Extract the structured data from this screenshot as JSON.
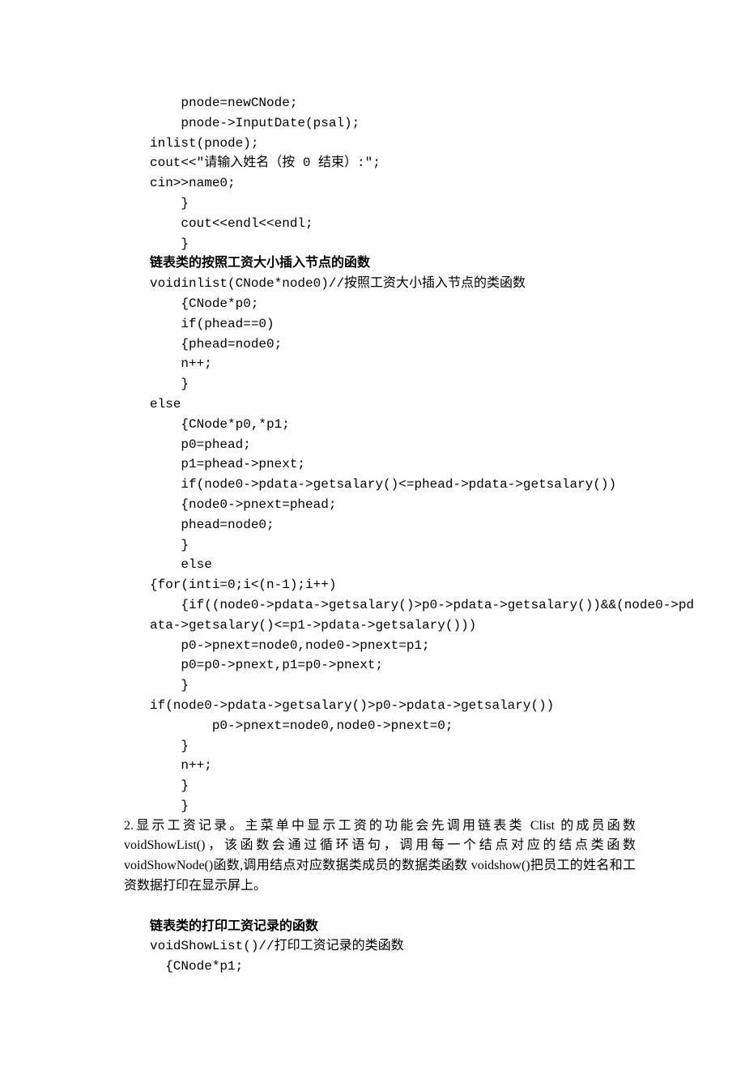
{
  "code_block1": {
    "lines": [
      "    pnode=newCNode;",
      "    pnode->InputDate(psal);",
      "inlist(pnode);",
      "cout<<\"请输入姓名（按 0 结束）:\";",
      "cin>>name0;",
      "    }",
      "    cout<<endl<<endl;",
      "    }"
    ]
  },
  "heading1": "链表类的按照工资大小插入节点的函数",
  "code_block2": {
    "lines": [
      "voidinlist(CNode*node0)//按照工资大小插入节点的类函数",
      "    {CNode*p0;",
      "    if(phead==0)",
      "    {phead=node0;",
      "    n++;",
      "    }",
      "else",
      "    {CNode*p0,*p1;",
      "    p0=phead;",
      "    p1=phead->pnext;",
      "    if(node0->pdata->getsalary()<=phead->pdata->getsalary())",
      "    {node0->pnext=phead;",
      "    phead=node0;",
      "    }",
      "    else",
      "{for(inti=0;i<(n-1);i++)",
      "    {if((node0->pdata->getsalary()>p0->pdata->getsalary())&&(node0->pd",
      "ata->getsalary()<=p1->pdata->getsalary()))",
      "    p0->pnext=node0,node0->pnext=p1;",
      "    p0=p0->pnext,p1=p0->pnext;",
      "    }",
      "if(node0->pdata->getsalary()>p0->pdata->getsalary())",
      "        p0->pnext=node0,node0->pnext=0;",
      "    }",
      "    n++;",
      "    }",
      "    }"
    ]
  },
  "paragraph": "2.显示工资记录。主菜单中显示工资的功能会先调用链表类 Clist 的成员函数 voidShowList()，该函数会通过循环语句，调用每一个结点对应的结点类函数 voidShowNode()函数,调用结点对应数据类成员的数据类函数 voidshow()把员工的姓名和工资数据打印在显示屏上。",
  "heading2": "链表类的打印工资记录的函数",
  "code_block3": {
    "lines": [
      "voidShowList()//打印工资记录的类函数",
      "  {CNode*p1;"
    ]
  }
}
